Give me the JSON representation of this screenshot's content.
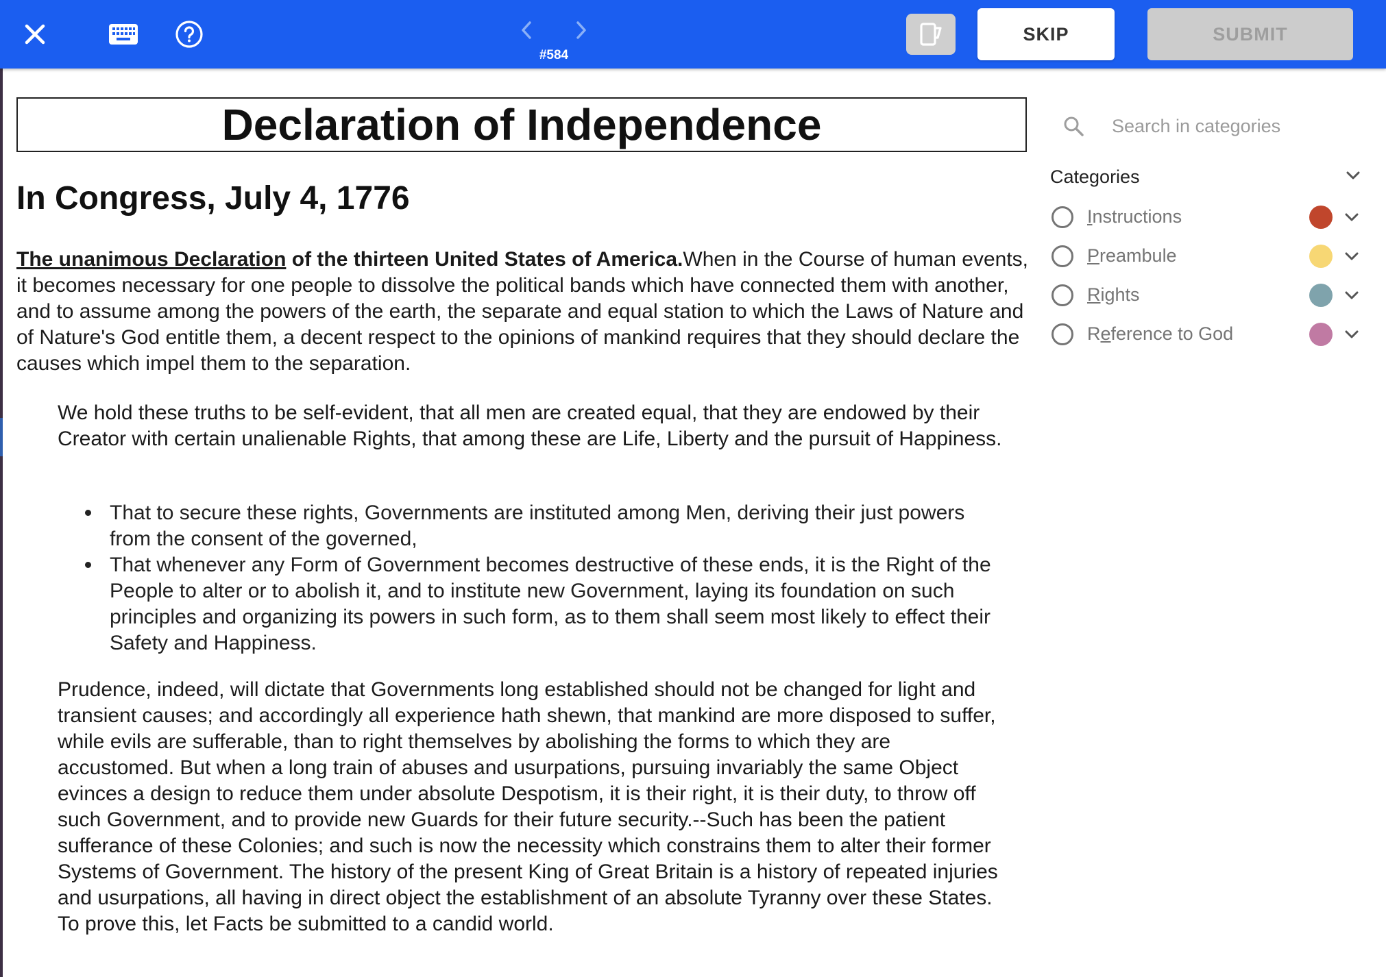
{
  "toolbar": {
    "task_id": "#584",
    "skip_label": "SKIP",
    "submit_label": "SUBMIT",
    "icons": [
      "close-icon",
      "keyboard-icon",
      "help-icon",
      "chevron-left-icon",
      "chevron-right-icon",
      "panel-toggle-icon"
    ]
  },
  "document": {
    "title": "Declaration of Independence",
    "subtitle": "In Congress, July 4, 1776",
    "intro_link": "The unanimous Declaration",
    "intro_bold": " of the thirteen United States of America.",
    "intro_text": "When in the Course of human events, it becomes necessary for one people to dissolve the political bands which have connected them with another, and to assume among the powers of the earth, the separate and equal station to which the Laws of Nature and of Nature's God entitle them, a decent respect to the opinions of mankind requires that they should declare the causes which impel them to the separation.",
    "truths": "We hold these truths to be self-evident, that all men are created equal, that they are endowed by their Creator with certain unalienable Rights, that among these are Life, Liberty and the pursuit of Happiness.",
    "bullets": [
      "That to secure these rights, Governments are instituted among Men, deriving their just powers from the consent of the governed,",
      "That whenever any Form of Government becomes destructive of these ends, it is the Right of the People to alter or to abolish it, and to institute new Government, laying its foundation on such principles and organizing its powers in such form, as to them shall seem most likely to effect their Safety and Happiness."
    ],
    "prudence": "Prudence, indeed, will dictate that Governments long established should not be changed for light and transient causes; and accordingly all experience hath shewn, that mankind are more disposed to suffer, while evils are sufferable, than to right themselves by abolishing the forms to which they are accustomed. But when a long train of abuses and usurpations, pursuing invariably the same Object evinces a design to reduce them under absolute Despotism, it is their right, it is their duty, to throw off such Government, and to provide new Guards for their future security.--Such has been the patient sufferance of these Colonies; and such is now the necessity which constrains them to alter their former Systems of Government. The history of the present King of Great Britain is a history of repeated injuries and usurpations, all having in direct object the establishment of an absolute Tyranny over these States. To prove this, let Facts be submitted to a candid world."
  },
  "sidebar": {
    "search_placeholder": "Search in categories",
    "categories_label": "Categories",
    "categories": [
      {
        "hotkey_pre": "",
        "hotkey": "I",
        "rest": "nstructions",
        "color": "#c0462c"
      },
      {
        "hotkey_pre": "",
        "hotkey": "P",
        "rest": "reambule",
        "color": "#f7d774"
      },
      {
        "hotkey_pre": "",
        "hotkey": "R",
        "rest": "ights",
        "color": "#7fa3ac"
      },
      {
        "hotkey_pre": "R",
        "hotkey": "e",
        "rest": "ference to God",
        "color": "#c07aa3"
      }
    ]
  }
}
